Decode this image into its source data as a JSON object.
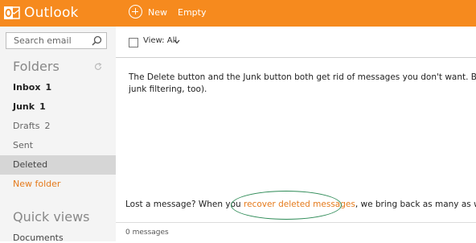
{
  "app": {
    "brand": "Outlook",
    "accent_color": "#f68a1e",
    "link_color": "#e57a1b"
  },
  "toolbar": {
    "new_label": "New",
    "new_icon": "plus-circle-icon",
    "empty_label": "Empty"
  },
  "sidebar": {
    "search_placeholder": "Search email",
    "folders_heading": "Folders",
    "folders": [
      {
        "name": "Inbox",
        "count": "1"
      },
      {
        "name": "Junk",
        "count": "1"
      },
      {
        "name": "Drafts",
        "count": "2"
      },
      {
        "name": "Sent",
        "count": ""
      },
      {
        "name": "Deleted",
        "count": "",
        "selected": true
      }
    ],
    "new_folder": "New folder",
    "quick_views_heading": "Quick views",
    "quick_views": [
      "Documents"
    ]
  },
  "main": {
    "view_label": "View: All",
    "message": [
      "The Delete button and the Junk button both get rid of messages you don't want. But the",
      "junk filtering, too)."
    ],
    "lost_prefix": "Lost a message? When you ",
    "recover_link": "recover deleted messages",
    "lost_suffix": ", we bring back as many as we can.",
    "message_count": "0 messages"
  }
}
